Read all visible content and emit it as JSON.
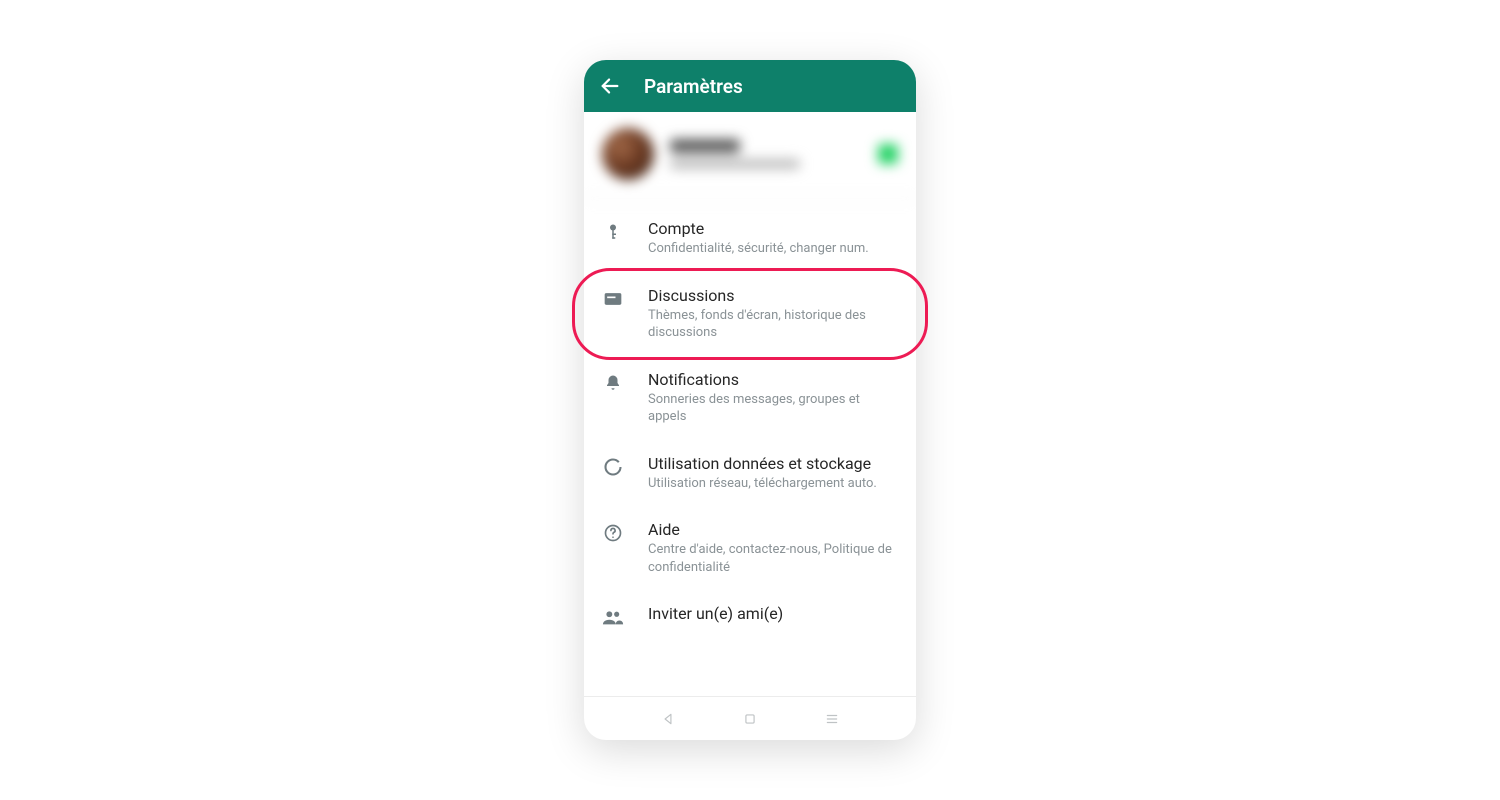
{
  "appbar": {
    "title": "Paramètres"
  },
  "settings": [
    {
      "key": "account",
      "title": "Compte",
      "subtitle": "Confidentialité, sécurité, changer num."
    },
    {
      "key": "chats",
      "title": "Discussions",
      "subtitle": "Thèmes, fonds d'écran, historique des discussions"
    },
    {
      "key": "notifications",
      "title": "Notifications",
      "subtitle": "Sonneries des messages, groupes et appels"
    },
    {
      "key": "storage",
      "title": "Utilisation données et stockage",
      "subtitle": "Utilisation réseau, téléchargement auto."
    },
    {
      "key": "help",
      "title": "Aide",
      "subtitle": "Centre d'aide, contactez-nous, Politique de confidentialité"
    },
    {
      "key": "invite",
      "title": "Inviter un(e) ami(e)",
      "subtitle": ""
    }
  ],
  "colors": {
    "brand": "#0e806a",
    "highlight": "#ed1b54"
  }
}
